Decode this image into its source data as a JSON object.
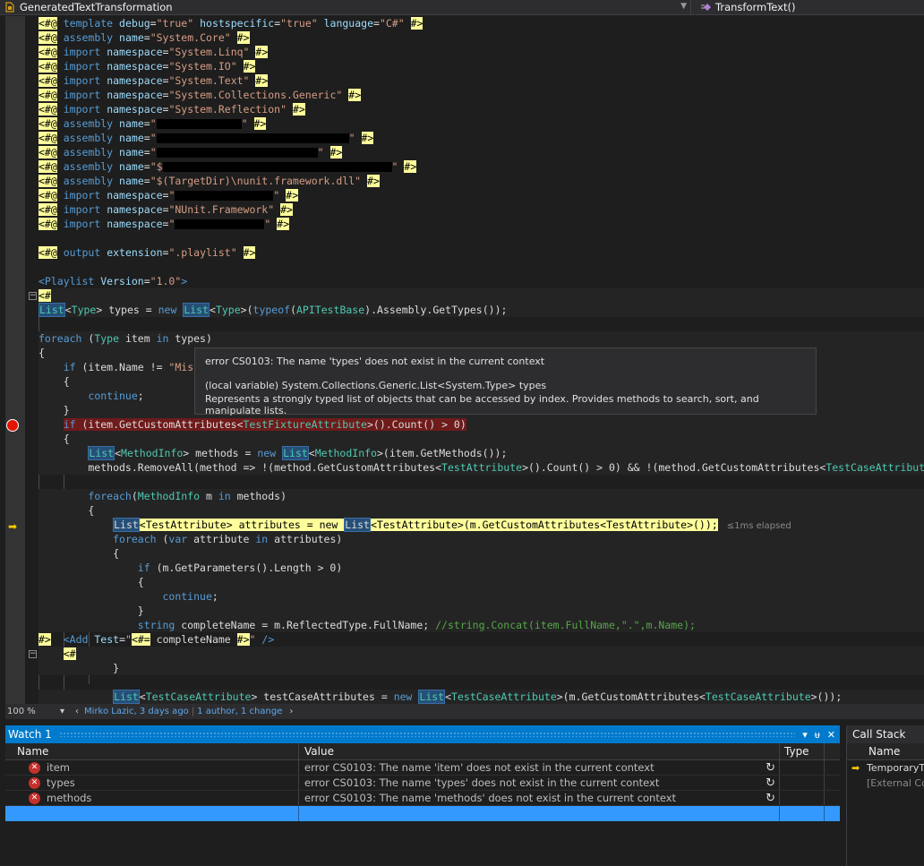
{
  "navbar": {
    "left_label": "GeneratedTextTransformation",
    "right_label": "TransformText()"
  },
  "tooltip": {
    "error": "error CS0103: The name 'types' does not exist in the current context",
    "type_line": "(local variable)  System.Collections.Generic.List<System.Type> types",
    "description": "Represents a strongly typed list of objects that can be accessed by index. Provides methods to search, sort, and manipulate lists."
  },
  "statusbar": {
    "zoom": "100 %",
    "author": "Mirko Lazic, 3 days ago",
    "changes": "1 author, 1 change"
  },
  "editor": {
    "elapsed": "≤1ms elapsed"
  },
  "watch": {
    "title": "Watch 1",
    "columns": [
      "Name",
      "Value",
      "Type"
    ],
    "rows": [
      {
        "name": "item",
        "value": "error CS0103: The name 'item' does not exist in the current context"
      },
      {
        "name": "types",
        "value": "error CS0103: The name 'types' does not exist in the current context"
      },
      {
        "name": "methods",
        "value": "error CS0103: The name 'methods' does not exist in the current context"
      }
    ],
    "controls": [
      "▾",
      "ᵾ",
      "✕"
    ]
  },
  "callstack": {
    "title": "Call Stack",
    "column": "Name",
    "rows": [
      "TemporaryT",
      "[External Co"
    ]
  },
  "colors": {
    "accent": "#007acc",
    "breakpoint": "#e51400",
    "template_tag": "#fefe9b"
  }
}
